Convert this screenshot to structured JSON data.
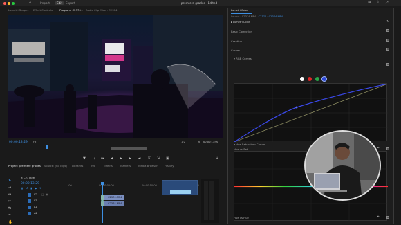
{
  "menu": {
    "items": [
      "Import",
      "Edit",
      "Export"
    ],
    "active": "Edit",
    "project_title": "premiere grades",
    "edited_label": "Edited"
  },
  "source_tabs": {
    "lumetri_scopes": "Lumetri Scopes",
    "effect_controls": "Effect Controls",
    "program": "Program: C2374",
    "audio_clip_mixer": "Audio Clip Mixer: C2374"
  },
  "program_monitor": {
    "timecode_current": "00:00:13:29",
    "fit": "Fit",
    "quality": "1/2",
    "timecode_duration": "00:00:11:00"
  },
  "lumetri": {
    "tab_label": "Lumetri Color",
    "source_line": "Source · C2374.MP4",
    "clip_line": "C2374 · C2374.MP4",
    "effect_name": "Lumetri Color",
    "sections": {
      "basic": "Basic Correction",
      "creative": "Creative",
      "curves": "Curves",
      "rgb_curves": "RGB Curves",
      "hue_sat": "Hue Saturation Curves",
      "hue_vs_sat": "Hue vs Sat",
      "hue_vs_hue": "Hue vs Hue"
    },
    "swatch_colors": [
      "#ffffff",
      "#e02828",
      "#2aa84a",
      "#2b45d8"
    ]
  },
  "project_tabs": {
    "project": "Project: premiere grades",
    "source": "Source: (no clips)",
    "libraries": "Libraries",
    "info": "Info",
    "effects": "Effects",
    "markers": "Markers",
    "media_browser": "Media Browser",
    "history": "History"
  },
  "timeline": {
    "sequence_name": "C2374",
    "timecode": "00:00:13:29",
    "ruler_marks": [
      ":00",
      "00:00:05:00",
      "00:00:10:00",
      "00:00:15:00"
    ],
    "tracks": [
      "V2",
      "V1",
      "A1",
      "A2"
    ],
    "clip_labels": [
      "C2374.MP4",
      "C2374.MP4"
    ]
  }
}
